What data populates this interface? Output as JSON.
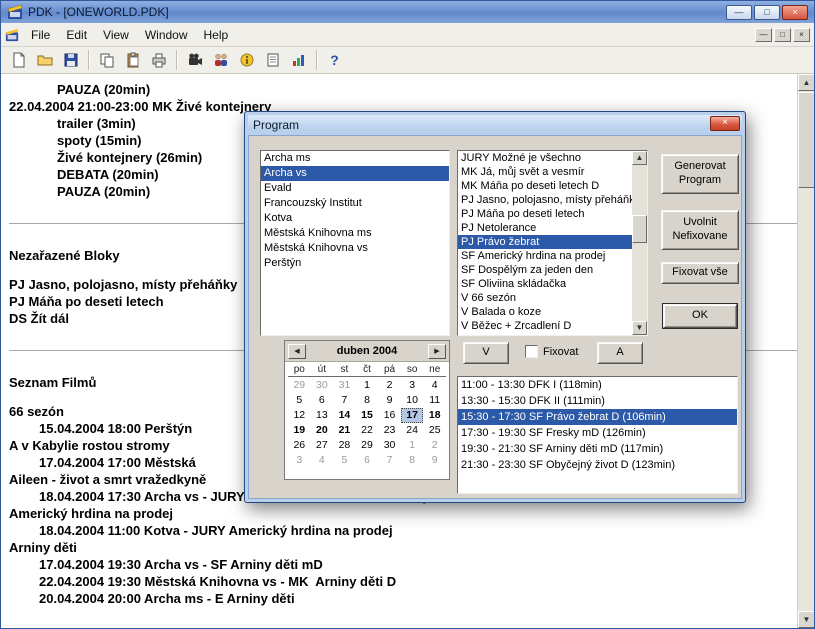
{
  "window": {
    "title": "PDK - [ONEWORLD.PDK]"
  },
  "glyphs": {
    "minimize": "—",
    "maximize": "□",
    "restore": "□",
    "close": "×",
    "up": "▲",
    "down": "▼",
    "left": "◀",
    "right": "▶",
    "help": "?"
  },
  "menubar": {
    "items": [
      {
        "text": "File"
      },
      {
        "text": "Edit"
      },
      {
        "text": "View"
      },
      {
        "text": "Window"
      },
      {
        "text": "Help"
      }
    ]
  },
  "toolbar": {
    "buttons": [
      "new-document",
      "open-folder",
      "save",
      "copy",
      "paste",
      "print",
      "movie-camera",
      "people",
      "info",
      "report",
      "chart",
      "help"
    ]
  },
  "document": {
    "lines": [
      {
        "text": "PAUZA (20min)",
        "indent2": true
      },
      {
        "text": "22.04.2004 21:00-23:00 MK Živé kontejnery"
      },
      {
        "text": "trailer (3min)",
        "indent2": true
      },
      {
        "text": "spoty (15min)",
        "indent2": true
      },
      {
        "text": "Živé kontejnery (26min)",
        "indent2": true
      },
      {
        "text": "DEBATA (20min)",
        "indent2": true
      },
      {
        "text": "PAUZA (20min)",
        "indent2": true
      },
      {
        "sep": true
      },
      {
        "text": "Nezařazené Bloky",
        "heading": true
      },
      {
        "gap": true
      },
      {
        "text": "PJ Jasno, polojasno, místy přeháňky"
      },
      {
        "text": "PJ Máňa po deseti letech"
      },
      {
        "text": "DS Žít dál"
      },
      {
        "sep": true
      },
      {
        "text": "Seznam Filmů",
        "heading": true
      },
      {
        "gap": true
      },
      {
        "text": "66 sezón"
      },
      {
        "text": "15.04.2004 18:00 Perštýn",
        "indent1": true
      },
      {
        "text": "A v Kabylie rostou stromy"
      },
      {
        "text": "17.04.2004 17:00 Městská",
        "indent1": true
      },
      {
        "text": "Aileen - život a smrt vražedkyně"
      },
      {
        "text": "18.04.2004 17:30 Archa vs - JURY Aileen - život a smrt vražedkyně mD",
        "indent1": true
      },
      {
        "text": "Americký hrdina na prodej"
      },
      {
        "text": "18.04.2004 11:00 Kotva - JURY Americký hrdina na prodej",
        "indent1": true
      },
      {
        "text": "Arniny děti"
      },
      {
        "text": "17.04.2004 19:30 Archa vs - SF Arniny děti mD",
        "indent1": true
      },
      {
        "text": "22.04.2004 19:30 Městská Knihovna vs - MK  Arniny děti D",
        "indent1": true
      },
      {
        "text": "20.04.2004 20:00 Archa ms - E Arniny děti",
        "indent1": true
      }
    ]
  },
  "dialog": {
    "title": "Program",
    "venue_list": {
      "items": [
        {
          "text": "Archa ms"
        },
        {
          "text": "Archa vs",
          "selected": true
        },
        {
          "text": "Evald"
        },
        {
          "text": "Francouzský Institut"
        },
        {
          "text": "Kotva"
        },
        {
          "text": "Městská Knihovna ms"
        },
        {
          "text": "Městská Knihovna vs"
        },
        {
          "text": "Perštýn"
        }
      ]
    },
    "film_list": {
      "items": [
        {
          "text": "JURY Možné je všechno"
        },
        {
          "text": "MK Já, můj svět a vesmír"
        },
        {
          "text": "MK Máňa po deseti letech D"
        },
        {
          "text": "PJ Jasno, polojasno, místy přeháňky"
        },
        {
          "text": "PJ Máňa po deseti letech"
        },
        {
          "text": "PJ Netolerance"
        },
        {
          "text": "PJ Právo žebrat",
          "selected": true
        },
        {
          "text": "SF Americký hrdina na prodej"
        },
        {
          "text": "SF Dospělým za jeden den"
        },
        {
          "text": "SF Oliviina skládačka"
        },
        {
          "text": "V 66 sezón"
        },
        {
          "text": "V Balada o koze"
        },
        {
          "text": "V Běžec + Zrcadlení D"
        }
      ]
    },
    "buttons": {
      "generate": "Generovat Program",
      "release": "Uvolnit Nefixovane",
      "fix_all": "Fixovat vše",
      "ok": "OK",
      "v": "V",
      "a": "A"
    },
    "fixovat_checkbox": {
      "label": "Fixovat",
      "checked": false
    },
    "calendar": {
      "month_label": "duben 2004",
      "selected_day": 17,
      "dow": [
        {
          "t": "po"
        },
        {
          "t": "út"
        },
        {
          "t": "st"
        },
        {
          "t": "čt"
        },
        {
          "t": "pá"
        },
        {
          "t": "so"
        },
        {
          "t": "ne"
        }
      ],
      "days": [
        {
          "n": 29,
          "muted": true
        },
        {
          "n": 30,
          "muted": true
        },
        {
          "n": 31,
          "muted": true
        },
        {
          "n": 1
        },
        {
          "n": 2
        },
        {
          "n": 3
        },
        {
          "n": 4
        },
        {
          "n": 5
        },
        {
          "n": 6
        },
        {
          "n": 7
        },
        {
          "n": 8
        },
        {
          "n": 9
        },
        {
          "n": 10
        },
        {
          "n": 11
        },
        {
          "n": 12
        },
        {
          "n": 13
        },
        {
          "n": 14,
          "bold": true
        },
        {
          "n": 15,
          "bold": true
        },
        {
          "n": 16
        },
        {
          "n": 17,
          "selected": true
        },
        {
          "n": 18,
          "bold": true
        },
        {
          "n": 19,
          "bold": true
        },
        {
          "n": 20,
          "bold": true
        },
        {
          "n": 21,
          "bold": true
        },
        {
          "n": 22
        },
        {
          "n": 23
        },
        {
          "n": 24
        },
        {
          "n": 25
        },
        {
          "n": 26
        },
        {
          "n": 27
        },
        {
          "n": 28
        },
        {
          "n": 29
        },
        {
          "n": 30
        },
        {
          "n": 1,
          "muted": true
        },
        {
          "n": 2,
          "muted": true
        },
        {
          "n": 3,
          "muted": true
        },
        {
          "n": 4,
          "muted": true
        },
        {
          "n": 5,
          "muted": true
        },
        {
          "n": 6,
          "muted": true
        },
        {
          "n": 7,
          "muted": true
        },
        {
          "n": 8,
          "muted": true
        },
        {
          "n": 9,
          "muted": true
        }
      ]
    },
    "schedule_list": {
      "items": [
        {
          "text": "11:00 - 13:30 DFK I (118min)"
        },
        {
          "text": "13:30 - 15:30 DFK II (111min)"
        },
        {
          "text": "15:30 - 17:30 SF Právo žebrat D (106min)",
          "selected": true
        },
        {
          "text": "17:30 - 19:30 SF Fresky mD (126min)"
        },
        {
          "text": "19:30 - 21:30 SF Arniny děti mD (117min)"
        },
        {
          "text": "21:30 - 23:30 SF Obyčejný život D (123min)"
        }
      ]
    }
  }
}
